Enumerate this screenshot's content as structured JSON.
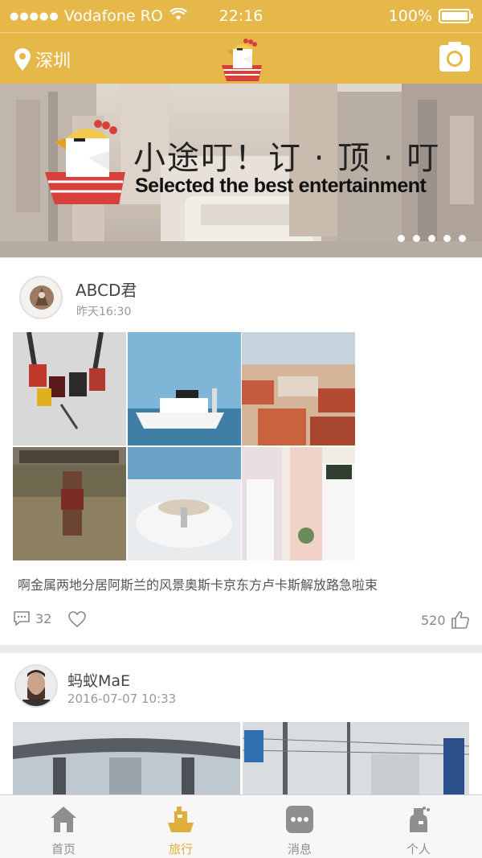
{
  "status_bar": {
    "signal_dots": "●●●●●",
    "carrier": "Vodafone RO",
    "time": "22:16",
    "battery": "100%"
  },
  "header": {
    "location": "深圳",
    "icons": {
      "location": "location-pin-icon",
      "logo": "chicken-boat-logo",
      "camera": "camera-icon"
    }
  },
  "banner": {
    "title_cn": "小途叮！订 · 顶 · 叮",
    "title_en": "Selected the best entertainment",
    "page_count": 5
  },
  "posts": [
    {
      "user": "ABCD君",
      "time": "昨天16:30",
      "caption": "啊金属两地分居阿斯兰的风景奥斯卡京东方卢卡斯解放路急啦束",
      "comments": "32",
      "likes": "520"
    },
    {
      "user": "蚂蚁MaE",
      "time": "2016-07-07   10:33"
    }
  ],
  "tabbar": {
    "tabs": [
      {
        "label": "首页",
        "icon": "home-icon"
      },
      {
        "label": "旅行",
        "icon": "boat-icon"
      },
      {
        "label": "消息",
        "icon": "message-icon"
      },
      {
        "label": "个人",
        "icon": "person-icon"
      }
    ],
    "active": "旅行"
  },
  "colors": {
    "brand_yellow": "#e6b84a",
    "active_tab": "#e0ae3a",
    "inactive_tab": "#8f8f8f"
  }
}
